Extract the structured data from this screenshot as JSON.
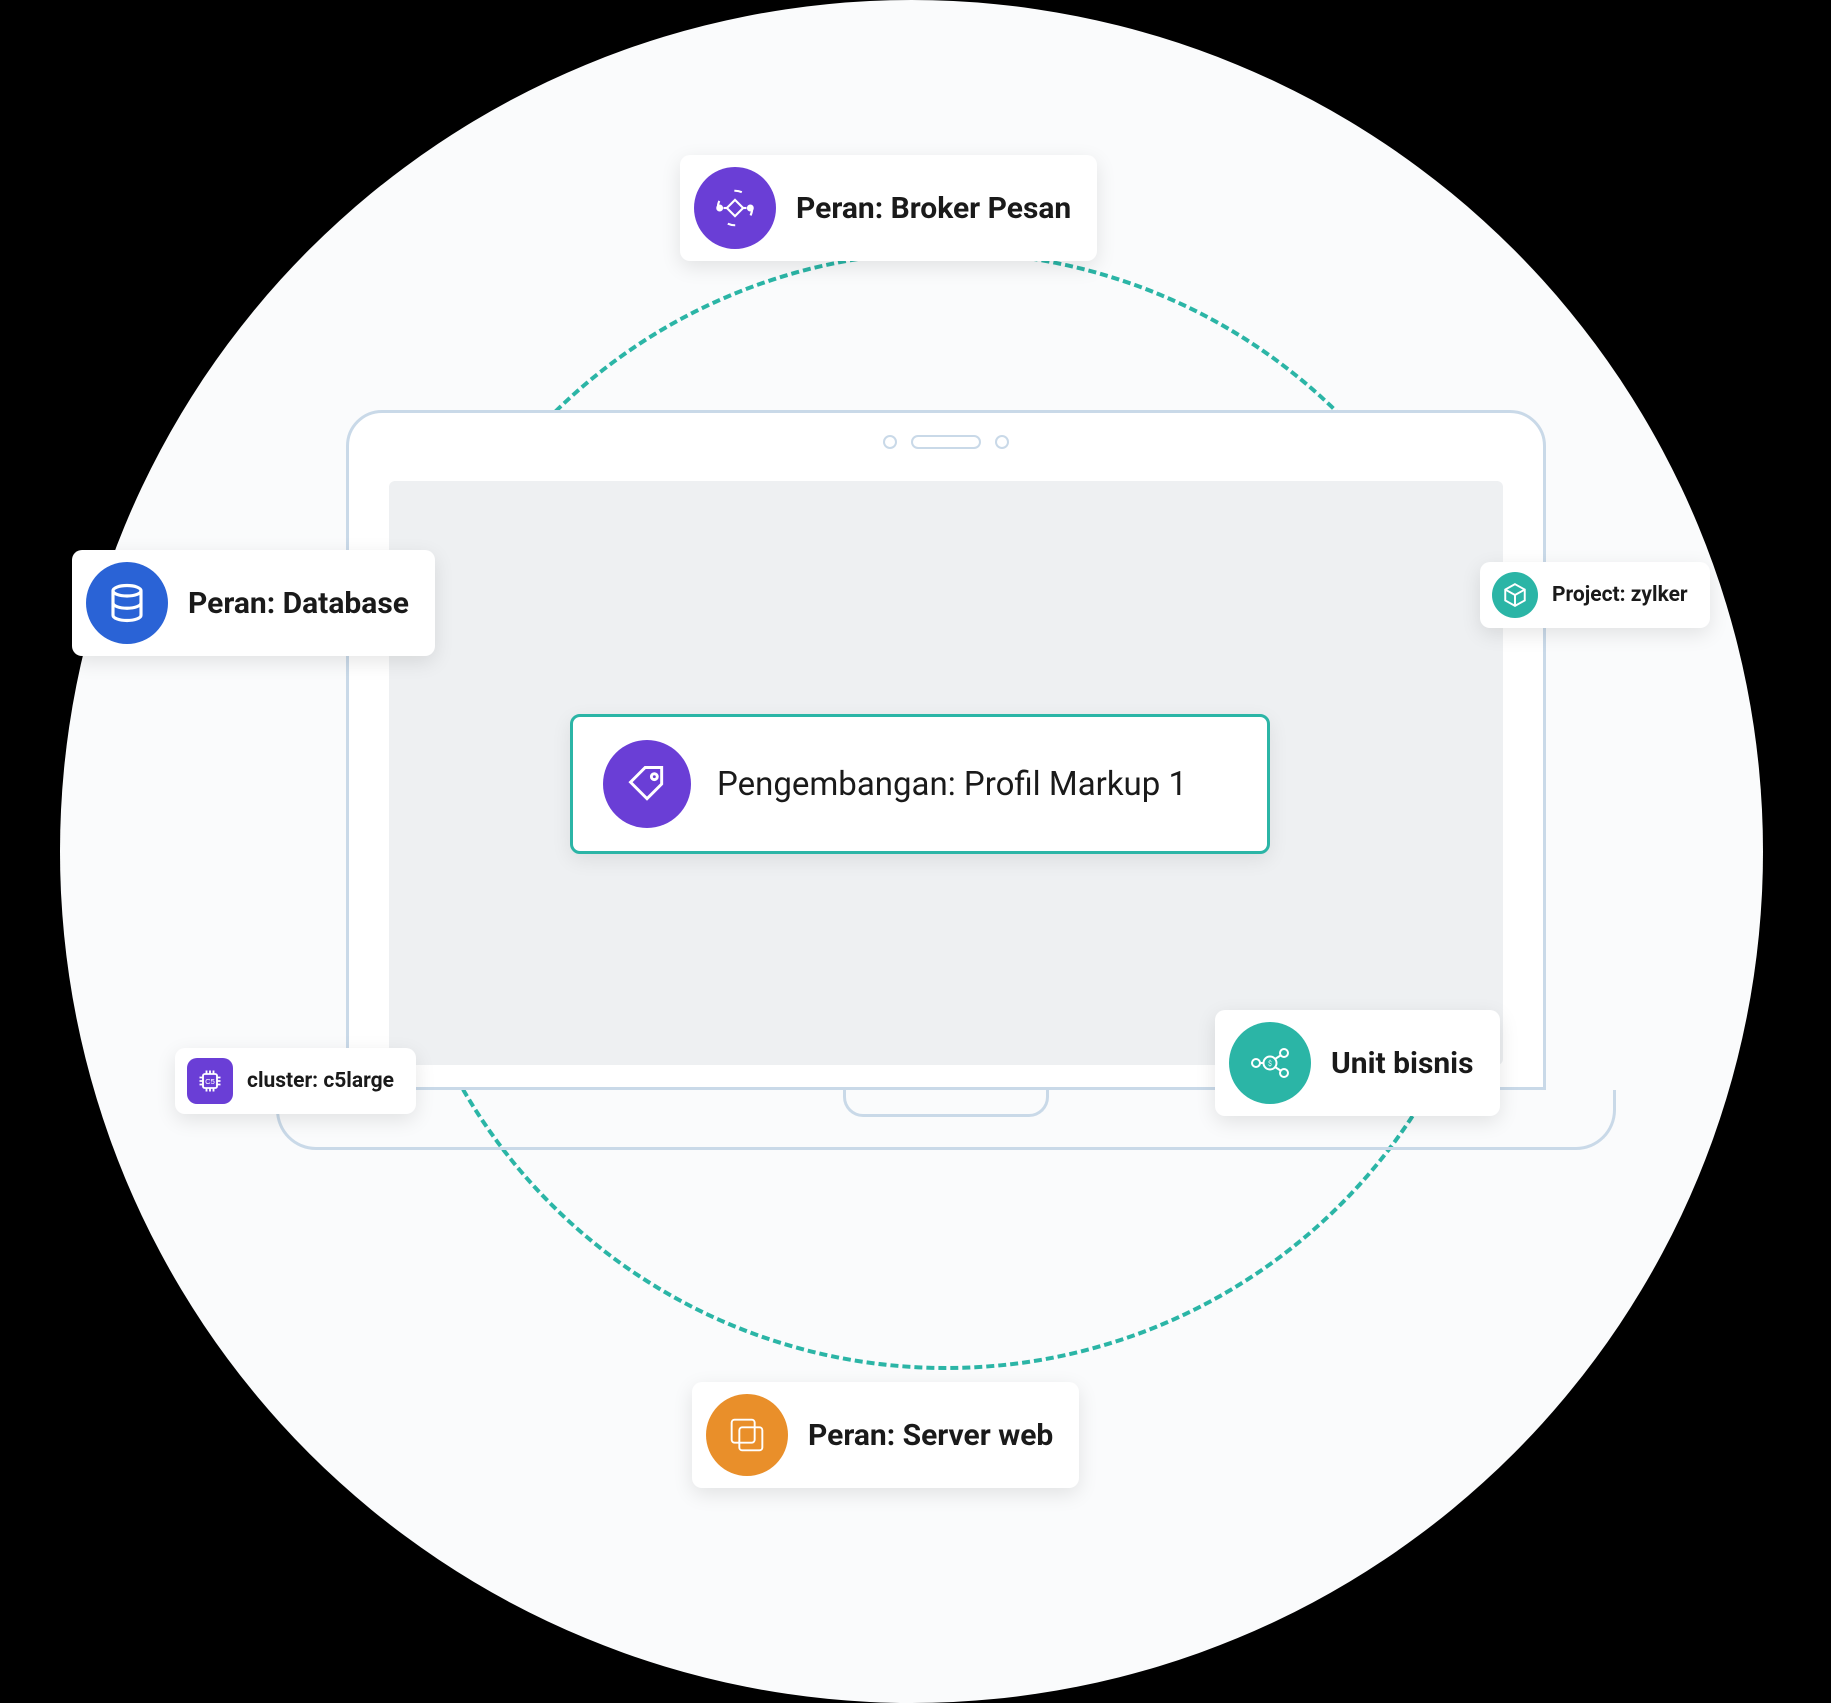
{
  "colors": {
    "purple": "#6a3ed6",
    "blue": "#2a63d6",
    "teal": "#2bb5a6",
    "orange": "#e98f2a"
  },
  "center": {
    "label": "Pengembangan: Profil Markup 1",
    "icon": "tag-icon"
  },
  "cards": {
    "broker": {
      "label": "Peran: Broker Pesan",
      "icon": "broker-icon"
    },
    "database": {
      "label": "Peran: Database",
      "icon": "database-icon"
    },
    "project": {
      "label": "Project: zylker",
      "icon": "cube-icon"
    },
    "cluster": {
      "label": "cluster: c5large",
      "icon": "chip-icon"
    },
    "business": {
      "label": "Unit bisnis",
      "icon": "business-icon"
    },
    "server": {
      "label": "Peran: Server web",
      "icon": "server-icon"
    }
  }
}
